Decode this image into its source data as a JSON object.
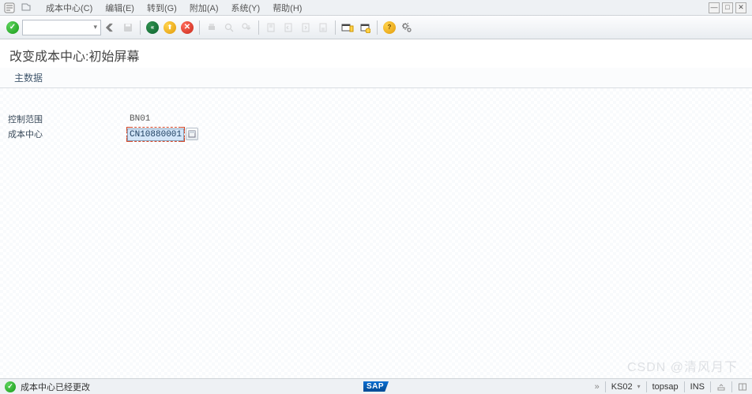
{
  "menubar": {
    "items": [
      "成本中心(C)",
      "编辑(E)",
      "转到(G)",
      "附加(A)",
      "系统(Y)",
      "帮助(H)"
    ]
  },
  "page": {
    "title": "改变成本中心:初始屏幕",
    "subtoolbar": "主数据"
  },
  "form": {
    "controlling_area": {
      "label": "控制范围",
      "value": "BN01"
    },
    "cost_center": {
      "label": "成本中心",
      "value": "CN10880001"
    }
  },
  "statusbar": {
    "message": "成本中心已经更改",
    "tcode": "KS02",
    "system": "topsap",
    "mode": "INS",
    "sap": "SAP"
  },
  "watermark": "CSDN @清风月下"
}
